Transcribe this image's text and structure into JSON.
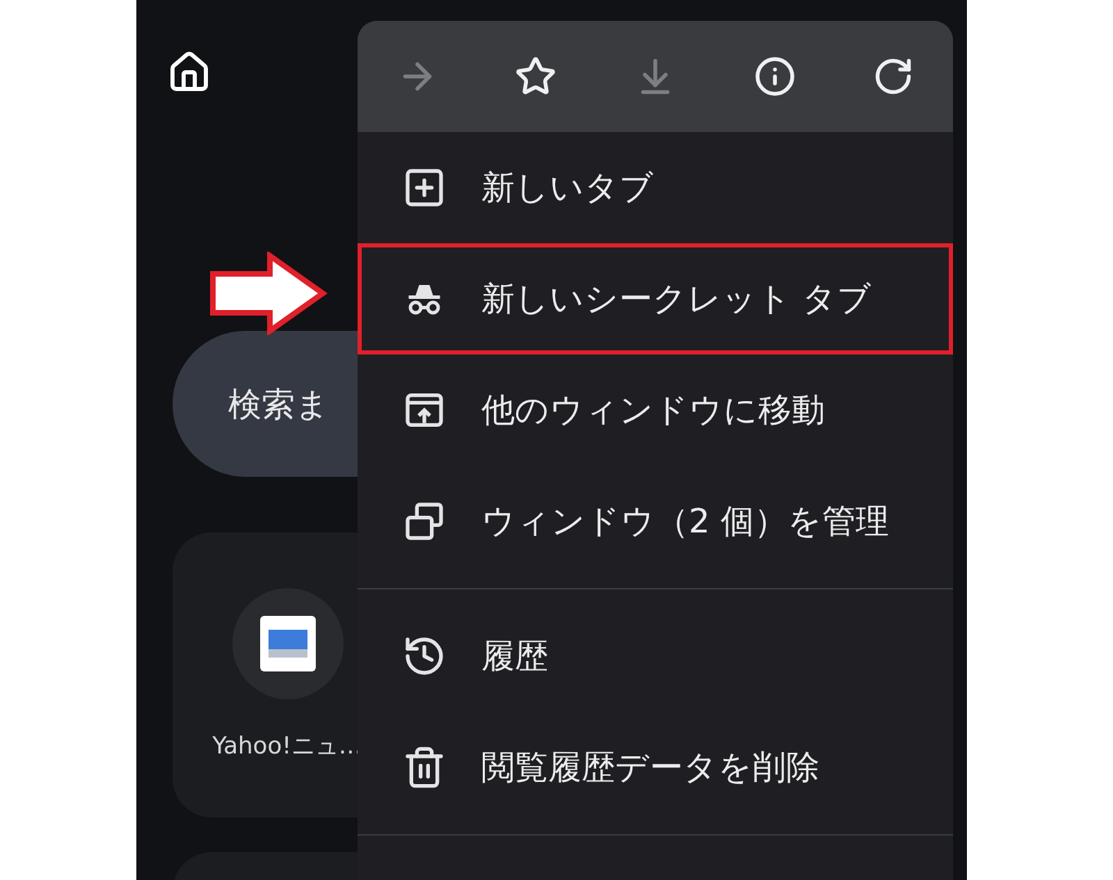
{
  "search_box": {
    "placeholder": "検索ま"
  },
  "shortcuts": [
    {
      "label": "Yahoo!ニュ…"
    }
  ],
  "menu": {
    "toolbar": [
      {
        "disabled": true
      },
      {
        "disabled": false
      },
      {
        "disabled": true
      },
      {
        "disabled": false
      },
      {
        "disabled": false
      }
    ],
    "sections": [
      {
        "items": [
          {
            "label": "新しいタブ",
            "highlighted": false
          },
          {
            "label": "新しいシークレット タブ",
            "highlighted": true
          },
          {
            "label": "他のウィンドウに移動",
            "highlighted": false
          },
          {
            "label": "ウィンドウ（2 個）を管理",
            "highlighted": false
          }
        ]
      },
      {
        "items": [
          {
            "label": "履歴",
            "highlighted": false
          },
          {
            "label": "閲覧履歴データを削除",
            "highlighted": false
          }
        ]
      }
    ]
  }
}
